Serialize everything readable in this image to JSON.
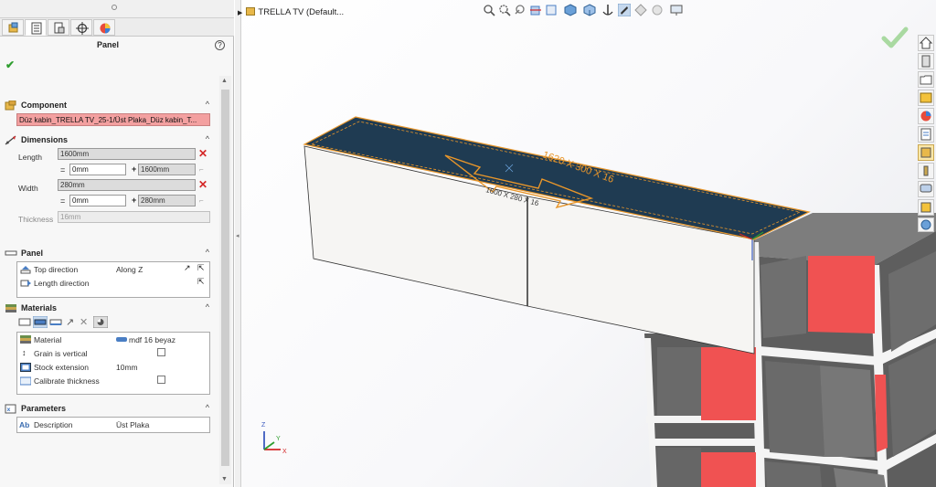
{
  "left_panel": {
    "tabs": [
      "feature-manager-tab",
      "property-manager-tab",
      "configuration-manager-tab",
      "dim-xpert-tab",
      "display-manager-tab"
    ],
    "title": "Panel",
    "help": "?",
    "component": {
      "header": "Component",
      "value": "Düz kabin_TRELLA TV_25-1/Üst Plaka_Düz kabin_T..."
    },
    "dimensions": {
      "header": "Dimensions",
      "length_label": "Length",
      "length_value": "1600mm",
      "length_eq_value": "0mm",
      "length_plus_value": "1600mm",
      "width_label": "Width",
      "width_value": "280mm",
      "width_eq_value": "0mm",
      "width_plus_value": "280mm",
      "thickness_label": "Thickness",
      "thickness_value": "16mm",
      "eq": "=",
      "plus": "+"
    },
    "panel": {
      "header": "Panel",
      "top_direction_label": "Top direction",
      "top_direction_value": "Along Z",
      "length_direction_label": "Length direction"
    },
    "materials": {
      "header": "Materials",
      "material_label": "Material",
      "material_value": "mdf 16 beyaz",
      "grain_label": "Grain is vertical",
      "stock_label": "Stock extension",
      "stock_value": "10mm",
      "calibrate_label": "Calibrate thickness"
    },
    "parameters": {
      "header": "Parameters",
      "desc_prefix": "Ab",
      "desc_label": "Description",
      "desc_value": "Üst Plaka"
    }
  },
  "viewport": {
    "tree_label": "TRELLA TV  (Default...",
    "dim_text_top": "1620 X 300 X 16",
    "dim_text_front": "1600 X 280 X 16",
    "triad": {
      "x": "X",
      "y": "Y",
      "z": "Z"
    }
  },
  "colors": {
    "panel_top": "#1f3b52",
    "accent_orange": "#e8962a",
    "cabinet_grey": "#6e6e6e",
    "cabinet_red": "#f05252",
    "ok_green": "#2f9e2f"
  },
  "toolbar_icons": [
    "zoom-to-fit-icon",
    "zoom-area-icon",
    "previous-view-icon",
    "section-view-icon",
    "view-orientation-icon",
    "display-style-icon",
    "hide-show-icon",
    "edit-appearance-icon",
    "apply-scene-icon",
    "view-settings-icon"
  ],
  "taskpane_icons": [
    "home-icon",
    "parts-library-icon",
    "file-explorer-icon",
    "view-palette-icon",
    "appearances-icon",
    "custom-properties-icon",
    "panel-tool-icon",
    "tool-icon",
    "forum-icon",
    "component-icon",
    "earth-icon"
  ]
}
